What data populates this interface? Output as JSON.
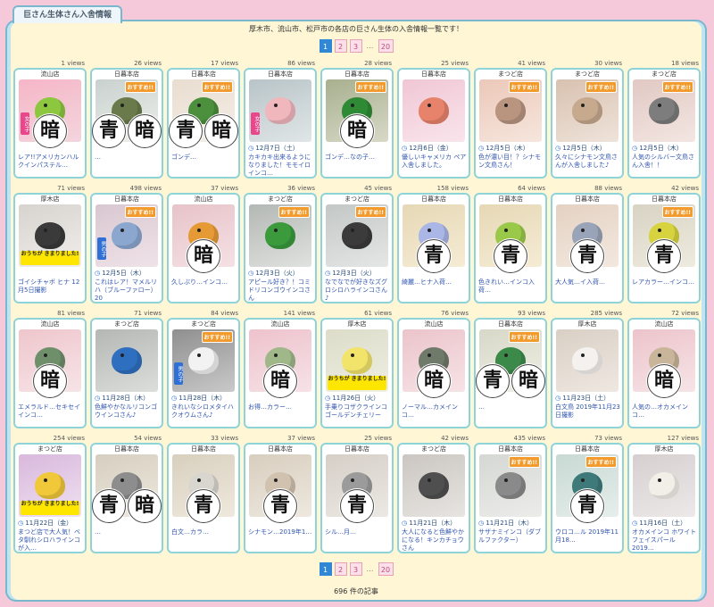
{
  "page": {
    "tab_title": "巨さん生体さん入舎情報",
    "subtitle": "厚木市、流山市、松戸市の各店の巨さん生体の入舎情報一覧です！",
    "footer": "696 件の記事"
  },
  "pager": {
    "pages": [
      "1",
      "2",
      "3"
    ],
    "ellipsis": "…",
    "last": "20",
    "active": "1"
  },
  "colors": {
    "background": "#f6c9da",
    "frame": "#bfe6f0",
    "panel": "#fff6d6",
    "card_border": "#8fd3da",
    "link": "#2f54b0",
    "recommend_badge": "#f29a2b",
    "sold_badge": "#ffe600",
    "active_page": "#2f87d6"
  },
  "badge_texts": {
    "recommend": "おすすめ!!",
    "sold": "おうちが きまりました!",
    "female": "女の子",
    "male": "男の子"
  },
  "cards": [
    {
      "views": "1 views",
      "store": "流山店",
      "date": "",
      "caption": "レア!!アメリカンハルクインパステル…",
      "rec": false,
      "sold": false,
      "gender": "女の子",
      "overlay": [
        "暗"
      ],
      "c1": "#f6b6c7",
      "c2": "#f3d5dd",
      "b": "#8dc63f"
    },
    {
      "views": "26 views",
      "store": "日暮本店",
      "date": "",
      "caption": "…",
      "rec": true,
      "sold": false,
      "gender": "",
      "overlay": [
        "青",
        "暗"
      ],
      "c1": "#c9d1cf",
      "c2": "#eef0ea",
      "b": "#6a7a4a"
    },
    {
      "views": "17 views",
      "store": "日暮本店",
      "date": "",
      "caption": "ゴンデ…",
      "rec": true,
      "sold": false,
      "gender": "",
      "overlay": [
        "青",
        "暗"
      ],
      "c1": "#e9ddd0",
      "c2": "#f5eee6",
      "b": "#4c8f3c"
    },
    {
      "views": "86 views",
      "store": "日暮本店",
      "date": "12月7日（土）",
      "caption": "カキカキ出来るようになりました！モモイロインコ…",
      "rec": false,
      "sold": false,
      "gender": "女の子",
      "overlay": [],
      "c1": "#b8c4c8",
      "c2": "#e0e6e7",
      "b": "#f0b7bd"
    },
    {
      "views": "28 views",
      "store": "日暮本店",
      "date": "",
      "caption": "ゴンデ…なの子…",
      "rec": true,
      "sold": false,
      "gender": "",
      "overlay": [
        "暗"
      ],
      "c1": "#a7b08e",
      "c2": "#d8d9c7",
      "b": "#2e8a34"
    },
    {
      "views": "25 views",
      "store": "日暮本店",
      "date": "12月6日（金）",
      "caption": "優しいキャメリカ ペア入舎しました。",
      "rec": false,
      "sold": false,
      "gender": "",
      "overlay": [],
      "c1": "#f0c6d5",
      "c2": "#f9e5ec",
      "b": "#e8836b"
    },
    {
      "views": "41 views",
      "store": "まつど店",
      "date": "12月5日（木）",
      "caption": "色が濃い目！？シナモン文鳥さん！",
      "rec": true,
      "sold": false,
      "gender": "",
      "overlay": [],
      "c1": "#ecc8b9",
      "c2": "#f6e6dd",
      "b": "#b99580"
    },
    {
      "views": "30 views",
      "store": "まつど店",
      "date": "12月5日（木）",
      "caption": "久々にシナモン文鳥さんが入舎しました♪",
      "rec": true,
      "sold": false,
      "gender": "",
      "overlay": [],
      "c1": "#d8c1b0",
      "c2": "#efe3da",
      "b": "#c7a98e"
    },
    {
      "views": "18 views",
      "store": "まつど店",
      "date": "12月5日（木）",
      "caption": "人気のシルバー文鳥さん入舎！！",
      "rec": true,
      "sold": false,
      "gender": "",
      "overlay": [],
      "c1": "#e1c8c3",
      "c2": "#f3e6e2",
      "b": "#7d7d7d"
    },
    {
      "views": "71 views",
      "store": "厚木店",
      "date": "",
      "caption": "ゴイシチャボ ヒナ 12月5日撮影",
      "rec": false,
      "sold": true,
      "gender": "",
      "overlay": [],
      "c1": "#d7d3cf",
      "c2": "#f0eeeb",
      "b": "#3a3a3a"
    },
    {
      "views": "498 views",
      "store": "日暮本店",
      "date": "12月5日（木）",
      "caption": "これはレア！マメルリハ（ブルーファロー）20",
      "rec": true,
      "sold": false,
      "gender": "男の子",
      "overlay": [],
      "c1": "#d9c7d0",
      "c2": "#efe3e8",
      "b": "#8ba7cf"
    },
    {
      "views": "37 views",
      "store": "流山店",
      "date": "",
      "caption": "久しぶり…インコ…",
      "rec": false,
      "sold": false,
      "gender": "",
      "overlay": [
        "暗"
      ],
      "c1": "#e7c3c9",
      "c2": "#f4e1e4",
      "b": "#e59a36"
    },
    {
      "views": "36 views",
      "store": "まつど店",
      "date": "12月3日（火）",
      "caption": "アピール好き？！コミドリコンゴウインコさん",
      "rec": true,
      "sold": false,
      "gender": "",
      "overlay": [],
      "c1": "#b4b8b5",
      "c2": "#dfe2df",
      "b": "#3a9a3c"
    },
    {
      "views": "45 views",
      "store": "まつど店",
      "date": "12月3日（火）",
      "caption": "なでなでが好きなズグロシロハラインコさん♪",
      "rec": true,
      "sold": false,
      "gender": "",
      "overlay": [],
      "c1": "#c3c7c6",
      "c2": "#e4e7e6",
      "b": "#3b3b3b"
    },
    {
      "views": "158 views",
      "store": "日暮本店",
      "date": "",
      "caption": "綺麗…ヒナ入荷…",
      "rec": false,
      "sold": false,
      "gender": "",
      "overlay": [
        "青"
      ],
      "c1": "#e6d8b6",
      "c2": "#f5ecd4",
      "b": "#a9b6e6"
    },
    {
      "views": "64 views",
      "store": "日暮本店",
      "date": "",
      "caption": "色きれい…インコ入荷…",
      "rec": false,
      "sold": false,
      "gender": "",
      "overlay": [
        "青"
      ],
      "c1": "#e6d8b6",
      "c2": "#f5ecd4",
      "b": "#9ac94a"
    },
    {
      "views": "88 views",
      "store": "日暮本店",
      "date": "",
      "caption": "大人気…イ入荷…",
      "rec": false,
      "sold": false,
      "gender": "",
      "overlay": [
        "青"
      ],
      "c1": "#e4d2c3",
      "c2": "#f3e8df",
      "b": "#9aa4b8"
    },
    {
      "views": "42 views",
      "store": "日暮本店",
      "date": "",
      "caption": "レアカラー…インコ…",
      "rec": true,
      "sold": false,
      "gender": "",
      "overlay": [
        "青"
      ],
      "c1": "#d8d3c3",
      "c2": "#eeebdf",
      "b": "#d6d33f"
    },
    {
      "views": "81 views",
      "store": "流山店",
      "date": "",
      "caption": "エメラルド…セキセイインコ…",
      "rec": false,
      "sold": false,
      "gender": "",
      "overlay": [
        "暗"
      ],
      "c1": "#eec6cc",
      "c2": "#f7e4e7",
      "b": "#6f8f6a"
    },
    {
      "views": "71 views",
      "store": "まつど店",
      "date": "11月28日（木）",
      "caption": "色鮮やかなルリコンゴウインコさん♪",
      "rec": false,
      "sold": false,
      "gender": "",
      "overlay": [],
      "c1": "#b5b7b4",
      "c2": "#dcdedb",
      "b": "#2f6fc0"
    },
    {
      "views": "84 views",
      "store": "まつど店",
      "date": "11月28日（木）",
      "caption": "きれいなシロメタイハクオウムさん♪",
      "rec": true,
      "sold": false,
      "gender": "男の子",
      "overlay": [],
      "c1": "#8f8f8f",
      "c2": "#c9c9c9",
      "b": "#f2f2f2"
    },
    {
      "views": "141 views",
      "store": "流山店",
      "date": "",
      "caption": "お得…カラー…",
      "rec": false,
      "sold": false,
      "gender": "",
      "overlay": [
        "暗"
      ],
      "c1": "#eec2cc",
      "c2": "#f6e2e7",
      "b": "#a0b78a"
    },
    {
      "views": "61 views",
      "store": "厚木店",
      "date": "11月26日（火）",
      "caption": "手乗りコザクラインコ ゴールデンチェリー",
      "rec": false,
      "sold": true,
      "gender": "",
      "overlay": [],
      "c1": "#dcdcc9",
      "c2": "#efefe3",
      "b": "#f2e36b"
    },
    {
      "views": "76 views",
      "store": "流山店",
      "date": "",
      "caption": "ノーマル…カメインコ…",
      "rec": false,
      "sold": false,
      "gender": "",
      "overlay": [
        "暗"
      ],
      "c1": "#ebc4cb",
      "c2": "#f6e3e6",
      "b": "#6f7a6a"
    },
    {
      "views": "93 views",
      "store": "日暮本店",
      "date": "",
      "caption": "…",
      "rec": true,
      "sold": false,
      "gender": "",
      "overlay": [
        "青",
        "暗"
      ],
      "c1": "#d8d8c9",
      "c2": "#efefe4",
      "b": "#3c8a4a"
    },
    {
      "views": "285 views",
      "store": "厚木店",
      "date": "11月23日（土）",
      "caption": "白文鳥 2019年11月23日撮影",
      "rec": false,
      "sold": false,
      "gender": "",
      "overlay": [],
      "c1": "#d9cfc5",
      "c2": "#efe8e1",
      "b": "#f4f1ee"
    },
    {
      "views": "72 views",
      "store": "流山店",
      "date": "",
      "caption": "人気の…オカメインコ…",
      "rec": false,
      "sold": false,
      "gender": "",
      "overlay": [
        "暗"
      ],
      "c1": "#ecc4cb",
      "c2": "#f6e4e7",
      "b": "#c9b69a"
    },
    {
      "views": "254 views",
      "store": "まつど店",
      "date": "11月22日（金）",
      "caption": "まつど店で大人気！ベタ馴れシロハラインコが入…",
      "rec": false,
      "sold": true,
      "gender": "",
      "overlay": [],
      "c1": "#d9b8dd",
      "c2": "#efe1f1",
      "b": "#f0c83a"
    },
    {
      "views": "54 views",
      "store": "日暮本店",
      "date": "",
      "caption": "…",
      "rec": false,
      "sold": false,
      "gender": "",
      "overlay": [
        "青",
        "暗"
      ],
      "c1": "#d6cfc0",
      "c2": "#eee9de",
      "b": "#8d8d8d"
    },
    {
      "views": "33 views",
      "store": "日暮本店",
      "date": "",
      "caption": "白文…カラ…",
      "rec": false,
      "sold": false,
      "gender": "",
      "overlay": [
        "青"
      ],
      "c1": "#d8cfbe",
      "c2": "#efe9dd",
      "b": "#d9d6cf"
    },
    {
      "views": "37 views",
      "store": "日暮本店",
      "date": "",
      "caption": "シナモン…2019年1…",
      "rec": false,
      "sold": false,
      "gender": "",
      "overlay": [
        "青"
      ],
      "c1": "#d8cebf",
      "c2": "#eee8de",
      "b": "#d1c2b0"
    },
    {
      "views": "25 views",
      "store": "日暮本店",
      "date": "",
      "caption": "シル…月…",
      "rec": false,
      "sold": false,
      "gender": "",
      "overlay": [
        "青"
      ],
      "c1": "#d5cfc7",
      "c2": "#ece8e3",
      "b": "#9b9b9b"
    },
    {
      "views": "42 views",
      "store": "まつど店",
      "date": "11月21日（木）",
      "caption": "大人になると色鮮やかになる！キンカチョウさん",
      "rec": false,
      "sold": false,
      "gender": "",
      "overlay": [],
      "c1": "#cbc6c1",
      "c2": "#e7e4e1",
      "b": "#4f4f4f"
    },
    {
      "views": "435 views",
      "store": "日暮本店",
      "date": "11月21日（木）",
      "caption": "サザナミインコ（ダブルファクター）",
      "rec": true,
      "sold": false,
      "gender": "",
      "overlay": [],
      "c1": "#d5d7d3",
      "c2": "#ecedea",
      "b": "#8a8a8a"
    },
    {
      "views": "73 views",
      "store": "日暮本店",
      "date": "",
      "caption": "ウロコ…ル 2019年11月18…",
      "rec": true,
      "sold": false,
      "gender": "",
      "overlay": [
        "青"
      ],
      "c1": "#c8d9d4",
      "c2": "#e6eeeb",
      "b": "#3e7a7a"
    },
    {
      "views": "127 views",
      "store": "厚木店",
      "date": "11月16日（土）",
      "caption": "オカメインコ ホワイトフェイスパール 2019…",
      "rec": false,
      "sold": false,
      "gender": "",
      "overlay": [],
      "c1": "#d6cfcf",
      "c2": "#ede9e9",
      "b": "#f2efe9"
    }
  ]
}
